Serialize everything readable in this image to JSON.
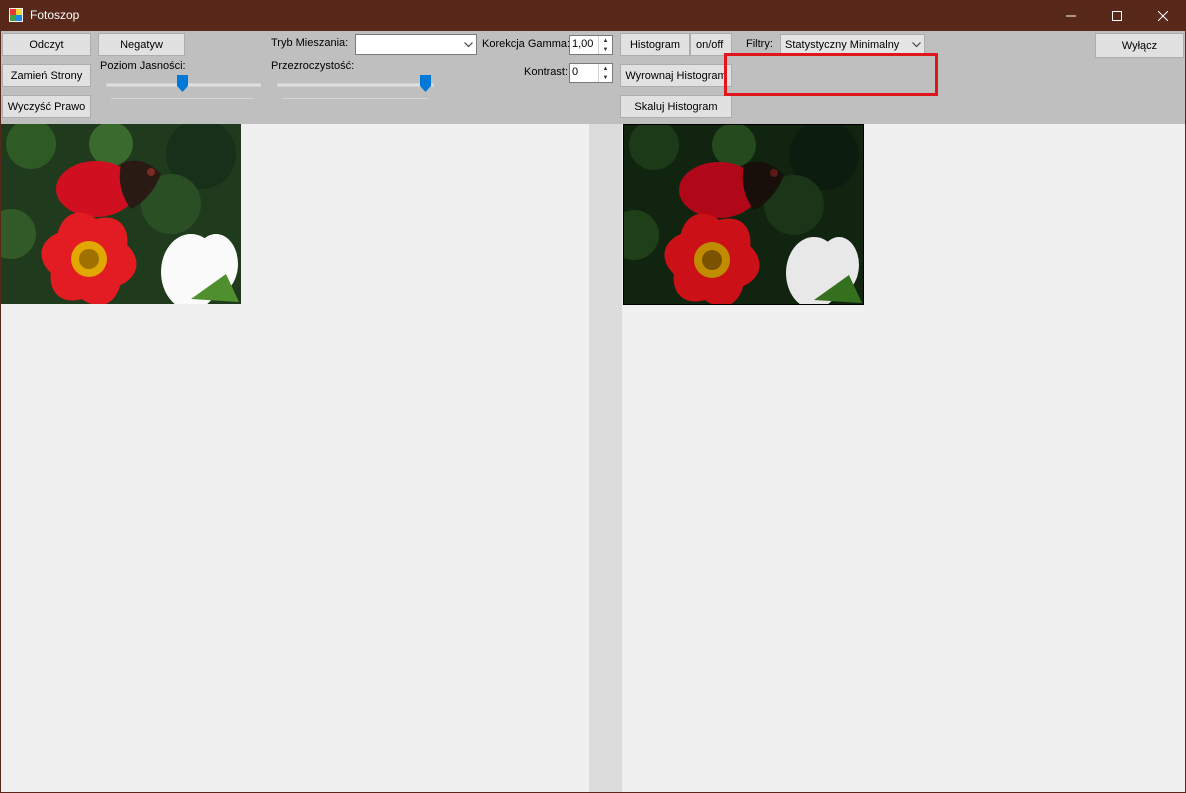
{
  "window": {
    "title": "Fotoszop",
    "icon": "paint-app-icon",
    "controls": {
      "minimize": "minimize-icon",
      "maximize": "maximize-icon",
      "close": "close-icon"
    }
  },
  "toolbar": {
    "odczyt": "Odczyt",
    "zamien_strony": "Zamień Strony",
    "wyczysc_prawo": "Wyczyść Prawo",
    "negatyw": "Negatyw",
    "poziom_jasnosci_label": "Poziom Jasności:",
    "brightness_level": 0.5,
    "tryb_mieszania_label": "Tryb Mieszania:",
    "tryb_mieszania_value": "",
    "przezroczystosc_label": "Przezroczystość:",
    "transparency_level": 1.0,
    "korekcja_gamma_label": "Korekcja Gamma:",
    "korekcja_gamma_value": "1,00",
    "kontrast_label": "Kontrast:",
    "kontrast_value": "0",
    "histogram": "Histogram",
    "on_off": "on/off",
    "wyrownaj_histogram": "Wyrownaj Histogram",
    "skaluj_histogram": "Skaluj Histogram",
    "filtry_label": "Filtry:",
    "filtry_value": "Statystyczny Minimalny",
    "wylacz": "Wyłącz"
  },
  "accent": "#0078d7",
  "title_bar_color": "#58291b",
  "highlight_color": "#e0161c",
  "left_image": {
    "icon": "flower-photo-original"
  },
  "right_image": {
    "icon": "flower-photo-filtered-darker"
  }
}
